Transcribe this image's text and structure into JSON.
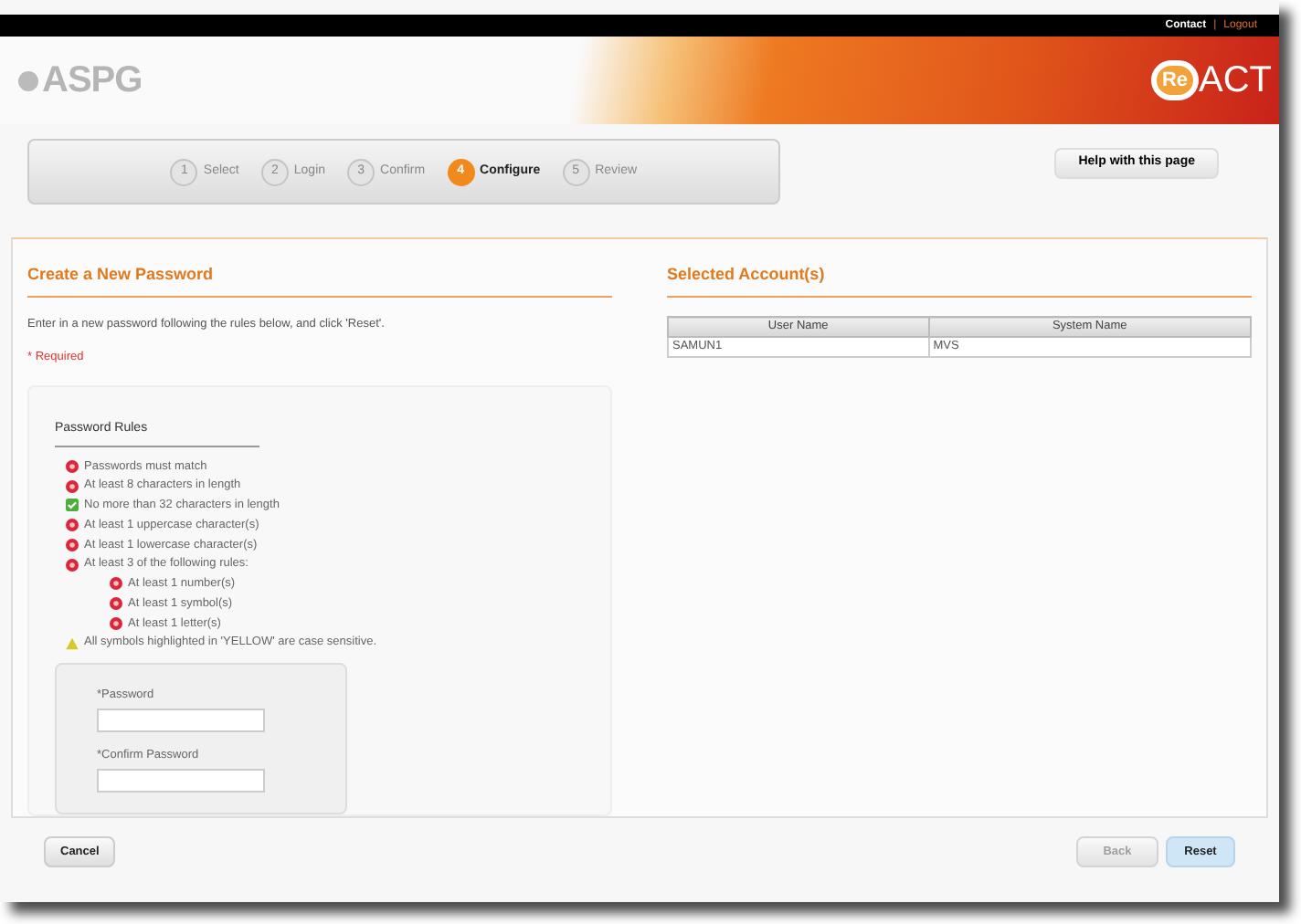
{
  "top_links": [
    "Contact",
    "|",
    "Logout"
  ],
  "logo": {
    "text": "ASPG",
    "brand_prefix": "Re",
    "brand_suffix": "ACT"
  },
  "steps": [
    {
      "number": "1",
      "label": "Select",
      "selected": false
    },
    {
      "number": "2",
      "label": "Login",
      "selected": false
    },
    {
      "number": "3",
      "label": "Confirm",
      "selected": false
    },
    {
      "number": "4",
      "label": "Configure",
      "selected": true
    },
    {
      "number": "5",
      "label": "Review",
      "selected": false
    }
  ],
  "help_button": "Help with this page",
  "left": {
    "title": "Create a New Password",
    "instructions": "Enter in a new password following the rules below, and click 'Reset'.",
    "required_note": "* Required",
    "rules_title": "Password Rules",
    "rules": [
      {
        "kind": "fail",
        "text": "Passwords must match"
      },
      {
        "kind": "fail",
        "text": "At least 8 characters in length"
      },
      {
        "kind": "pass",
        "text": "No more than 32 characters in length"
      },
      {
        "kind": "fail",
        "text": "At least 1 uppercase character(s)"
      },
      {
        "kind": "fail",
        "text": "At least 1 lowercase character(s)"
      },
      {
        "kind": "fail",
        "text": "At least 3 of the following rules:",
        "children": [
          {
            "kind": "fail",
            "text": "At least 1 number(s)"
          },
          {
            "kind": "fail",
            "text": "At least 1 symbol(s)"
          },
          {
            "kind": "fail",
            "text": "At least 1 letter(s)"
          }
        ]
      },
      {
        "kind": "warn",
        "text": "All symbols highlighted in 'YELLOW' are case sensitive."
      }
    ],
    "fields": [
      {
        "label": "*Password"
      },
      {
        "label": "*Confirm Password"
      }
    ]
  },
  "right": {
    "title": "Selected Account(s)",
    "columns": [
      "User Name",
      "System Name"
    ],
    "rows": [
      [
        "SAMUN1",
        "MVS"
      ]
    ]
  },
  "buttons": [
    {
      "label": "Cancel",
      "disabled": false,
      "kind": "secondary"
    },
    {
      "label": "Back",
      "disabled": true,
      "kind": "secondary"
    },
    {
      "label": "Reset",
      "disabled": false,
      "kind": "primary"
    }
  ]
}
